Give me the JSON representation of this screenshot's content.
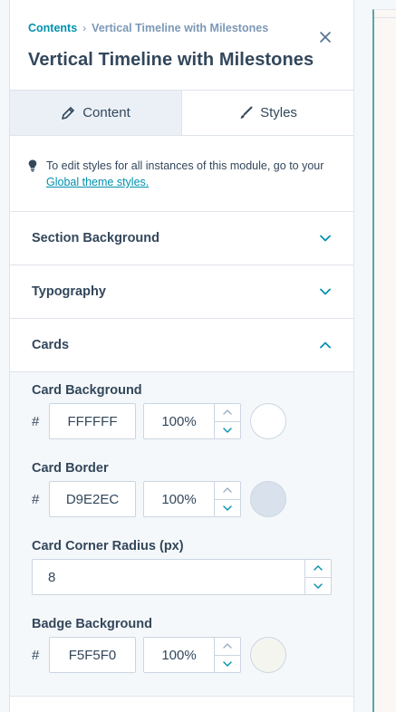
{
  "breadcrumb": {
    "root": "Contents",
    "separator": "›",
    "current": "Vertical Timeline with Milestones"
  },
  "title": "Vertical Timeline with Milestones",
  "tabs": [
    {
      "label": "Content",
      "icon": "pencil-icon",
      "active": false
    },
    {
      "label": "Styles",
      "icon": "brush-icon",
      "active": true
    }
  ],
  "notice": {
    "text": "To edit styles for all instances of this module, go to your",
    "link": "Global theme styles."
  },
  "sections": {
    "background": "Section Background",
    "typography": "Typography",
    "cards": "Cards"
  },
  "fields": {
    "card_background": {
      "label": "Card Background",
      "prefix": "#",
      "hex": "FFFFFF",
      "opacity": "100%",
      "swatch": "#FFFFFF"
    },
    "card_border": {
      "label": "Card Border",
      "prefix": "#",
      "hex": "D9E2EC",
      "opacity": "100%",
      "swatch": "#D9E2EC"
    },
    "corner_radius": {
      "label": "Card Corner Radius (px)",
      "value": "8"
    },
    "badge_background": {
      "label": "Badge Background",
      "prefix": "#",
      "hex": "F5F5F0",
      "opacity": "100%",
      "swatch": "#F5F5F0"
    }
  },
  "colors": {
    "accent": "#0091ae",
    "text": "#33475b",
    "muted": "#7c98b6",
    "border": "#cbd6e2"
  }
}
